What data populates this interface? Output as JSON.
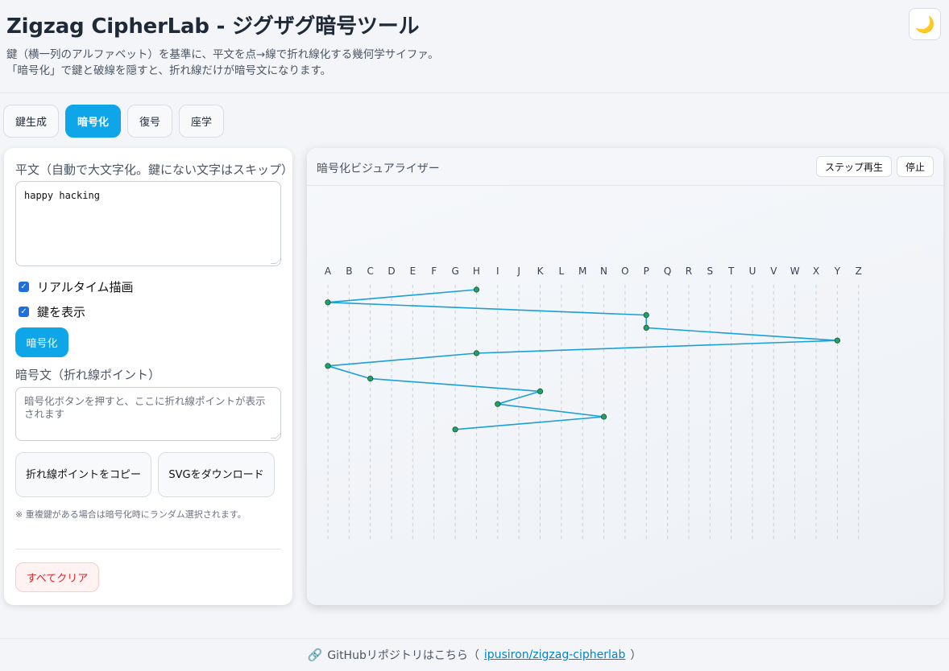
{
  "header": {
    "title": "Zigzag CipherLab - ジグザグ暗号ツール",
    "subtitle_line1": "鍵（横一列のアルファベット）を基準に、平文を点→線で折れ線化する幾何学サイファ。",
    "subtitle_line2": "「暗号化」で鍵と破線を隠すと、折れ線だけが暗号文になります。",
    "theme_icon": "🌙"
  },
  "tabs": [
    {
      "label": "鍵生成"
    },
    {
      "label": "暗号化",
      "active": true
    },
    {
      "label": "復号"
    },
    {
      "label": "座学"
    }
  ],
  "left": {
    "plaintext_label": "平文（自動で大文字化。鍵にない文字はスキップ）",
    "plaintext_value": "happy hacking",
    "realtime_label": "リアルタイム描画",
    "realtime_checked": true,
    "show_key_label": "鍵を表示",
    "show_key_checked": true,
    "encrypt_button": "暗号化",
    "cipher_label": "暗号文（折れ線ポイント）",
    "cipher_placeholder": "暗号化ボタンを押すと、ここに折れ線ポイントが表示されます",
    "copy_button": "折れ線ポイントをコピー",
    "svg_button": "SVGをダウンロード",
    "note": "※ 重複鍵がある場合は暗号化時にランダム選択されます。",
    "clear_button": "すべてクリア"
  },
  "viz": {
    "title": "暗号化ビジュアライザー",
    "step_button": "ステップ再生",
    "stop_button": "停止",
    "key_letters": [
      "A",
      "B",
      "C",
      "D",
      "E",
      "F",
      "G",
      "H",
      "I",
      "J",
      "K",
      "L",
      "M",
      "N",
      "O",
      "P",
      "Q",
      "R",
      "S",
      "T",
      "U",
      "V",
      "W",
      "X",
      "Y",
      "Z"
    ],
    "path_letters": [
      "H",
      "A",
      "P",
      "P",
      "Y",
      "H",
      "A",
      "C",
      "K",
      "I",
      "N",
      "G"
    ],
    "line_color": "#1a9fd8",
    "point_color": "#22a06b"
  },
  "footer": {
    "icon": "🔗",
    "text": "GitHubリポジトリはこちら（",
    "link": "ipusiron/zigzag-cipherlab",
    "close": "）"
  }
}
